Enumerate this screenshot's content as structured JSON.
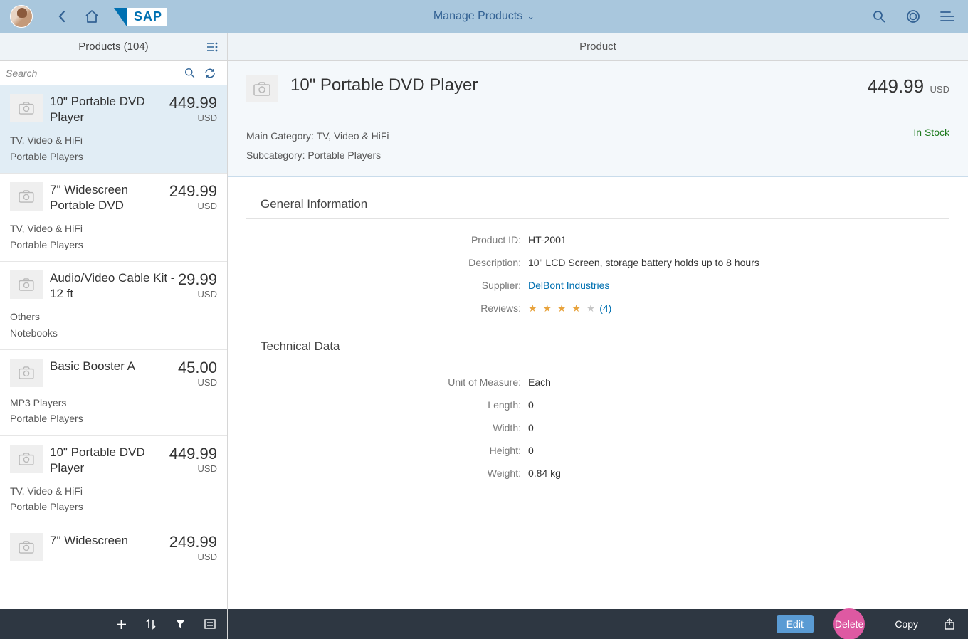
{
  "shell": {
    "title": "Manage Products"
  },
  "master": {
    "title": "Products (104)",
    "search_placeholder": "Search"
  },
  "list_items": [
    {
      "name": "10\" Portable DVD Player",
      "price": "449.99",
      "curr": "USD",
      "cat": "TV, Video & HiFi",
      "sub": "Portable Players",
      "selected": true
    },
    {
      "name": "7\" Widescreen Portable DVD",
      "price": "249.99",
      "curr": "USD",
      "cat": "TV, Video & HiFi",
      "sub": "Portable Players"
    },
    {
      "name": "Audio/Video Cable Kit - 12 ft",
      "price": "29.99",
      "curr": "USD",
      "cat": "Others",
      "sub": "Notebooks"
    },
    {
      "name": "Basic Booster A",
      "price": "45.00",
      "curr": "USD",
      "cat": "MP3 Players",
      "sub": "Portable Players"
    },
    {
      "name": "10\" Portable DVD Player",
      "price": "449.99",
      "curr": "USD",
      "cat": "TV, Video & HiFi",
      "sub": "Portable Players"
    },
    {
      "name": "7\" Widescreen",
      "price": "249.99",
      "curr": "USD",
      "cat": "",
      "sub": ""
    }
  ],
  "detail": {
    "header_title": "Product",
    "title": "10\" Portable DVD Player",
    "price": "449.99",
    "curr": "USD",
    "main_cat_label": "Main Category: ",
    "main_cat": "TV, Video & HiFi",
    "subcat_label": "Subcategory: ",
    "subcat": "Portable Players",
    "status": "In Stock",
    "section1": "General Information",
    "section2": "Technical Data",
    "general": {
      "product_id_label": "Product ID:",
      "product_id": "HT-2001",
      "desc_label": "Description:",
      "desc": "10\" LCD Screen, storage battery holds up to 8 hours",
      "supplier_label": "Supplier:",
      "supplier": "DelBont Industries",
      "reviews_label": "Reviews:",
      "reviews_count": "(4)"
    },
    "tech": {
      "uom_label": "Unit of Measure:",
      "uom": "Each",
      "length_label": "Length:",
      "length": "0",
      "width_label": "Width:",
      "width": "0",
      "height_label": "Height:",
      "height": "0",
      "weight_label": "Weight:",
      "weight": "0.84 kg"
    },
    "buttons": {
      "edit": "Edit",
      "delete": "Delete",
      "copy": "Copy"
    }
  }
}
